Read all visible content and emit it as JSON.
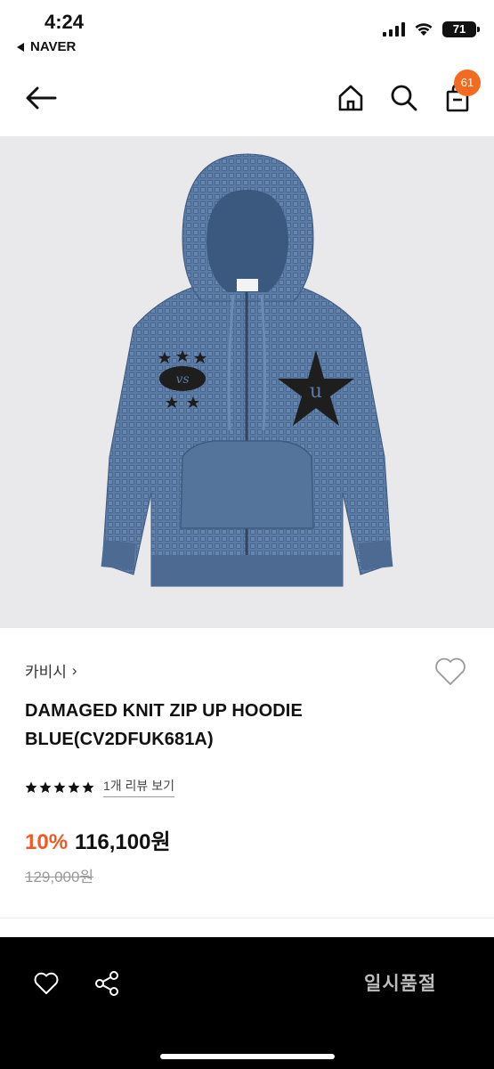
{
  "status_bar": {
    "time": "4:24",
    "back_app": "NAVER",
    "battery": "71"
  },
  "nav": {
    "cart_count": "61"
  },
  "product": {
    "brand": "카비시",
    "brand_chevron": "›",
    "title_line1": "DAMAGED KNIT ZIP UP HOODIE",
    "title_line2": "BLUE(CV2DFUK681A)",
    "rating_stars": 5,
    "review_link": "1개 리뷰 보기",
    "discount": "10%",
    "price": "116,100원",
    "original_price": "129,000원"
  },
  "bottom_bar": {
    "status_label": "일시품절"
  },
  "colors": {
    "accent": "#ef5a24",
    "badge": "#f26b21",
    "hoodie": "#5a7aa3",
    "image_bg": "#e9e9eb"
  }
}
